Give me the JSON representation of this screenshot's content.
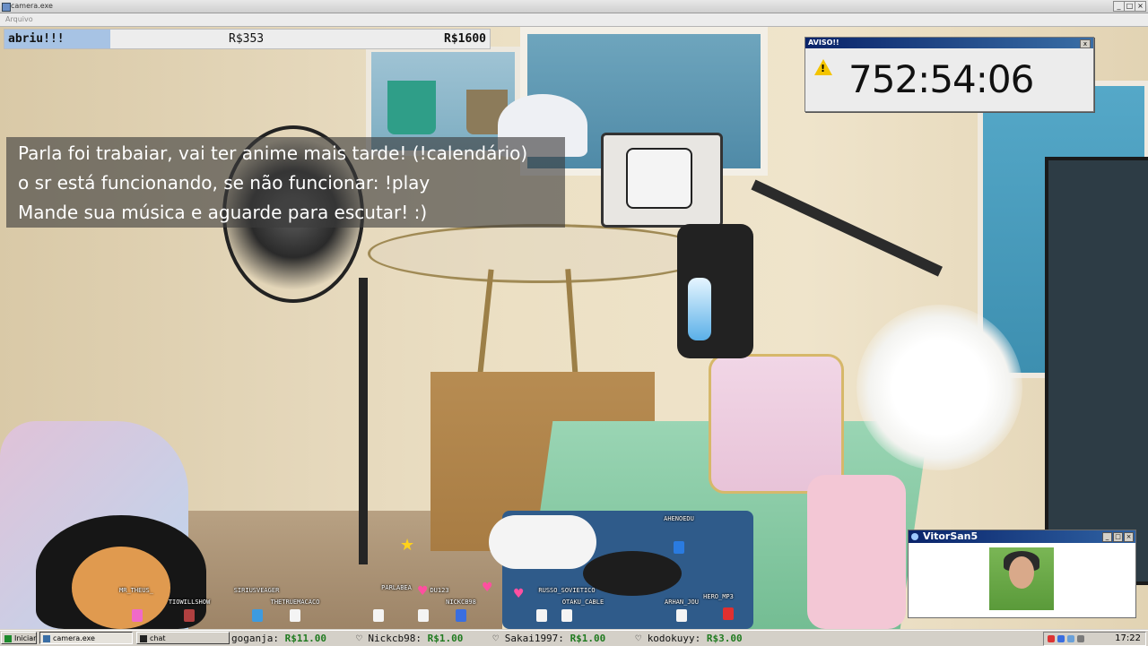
{
  "window": {
    "title": "camera.exe",
    "menu_item": "Arquivo"
  },
  "stats": {
    "status": "abriu!!!",
    "value1": "R$353",
    "value2": "R$1600"
  },
  "overlay": {
    "lines": [
      "Parla foi trabaiar, vai ter anime mais tarde! (!calendário)",
      "o sr está funcionando, se não funcionar: !play",
      "Mande sua música e aguarde para escutar! :)"
    ]
  },
  "alert": {
    "title": "AVISO!!",
    "timer": "752:54:06",
    "close": "x"
  },
  "cam": {
    "title": "VitorSan5"
  },
  "avatars": [
    {
      "name": "MR_THEUS_",
      "color": "#f06ac8"
    },
    {
      "name": "TIOWILLSHOW",
      "color": "#b04040"
    },
    {
      "name": "SIRIUSVEAGER",
      "color": "#3d9be0"
    },
    {
      "name": "THETRUEMACACO",
      "color": "#f4f4f4"
    },
    {
      "name": "PARLABEA",
      "color": "#f4f4f4"
    },
    {
      "name": "DU123",
      "color": "#f4f4f4"
    },
    {
      "name": "NICKCB98",
      "color": "#3a6ee0"
    },
    {
      "name": "RUSSO_SOVIETICO",
      "color": "#f4f4f4"
    },
    {
      "name": "OTAKU_CABLE",
      "color": "#f4f4f4"
    },
    {
      "name": "AHENOEDU",
      "color": "#2a7be0"
    },
    {
      "name": "ARHAN_JOU",
      "color": "#f4f4f4"
    },
    {
      "name": "HERO_MP3",
      "color": "#e03030"
    }
  ],
  "taskbar": {
    "start": "Iniciar",
    "tasks": [
      "camera.exe",
      "chat"
    ],
    "ticker": [
      {
        "user": "goganja:",
        "amount": "R$11.00"
      },
      {
        "user": "Nickcb98:",
        "amount": "R$1.00"
      },
      {
        "user": "Sakai1997:",
        "amount": "R$1.00"
      },
      {
        "user": "kodokuyy:",
        "amount": "R$3.00"
      }
    ],
    "clock": "17:22"
  }
}
